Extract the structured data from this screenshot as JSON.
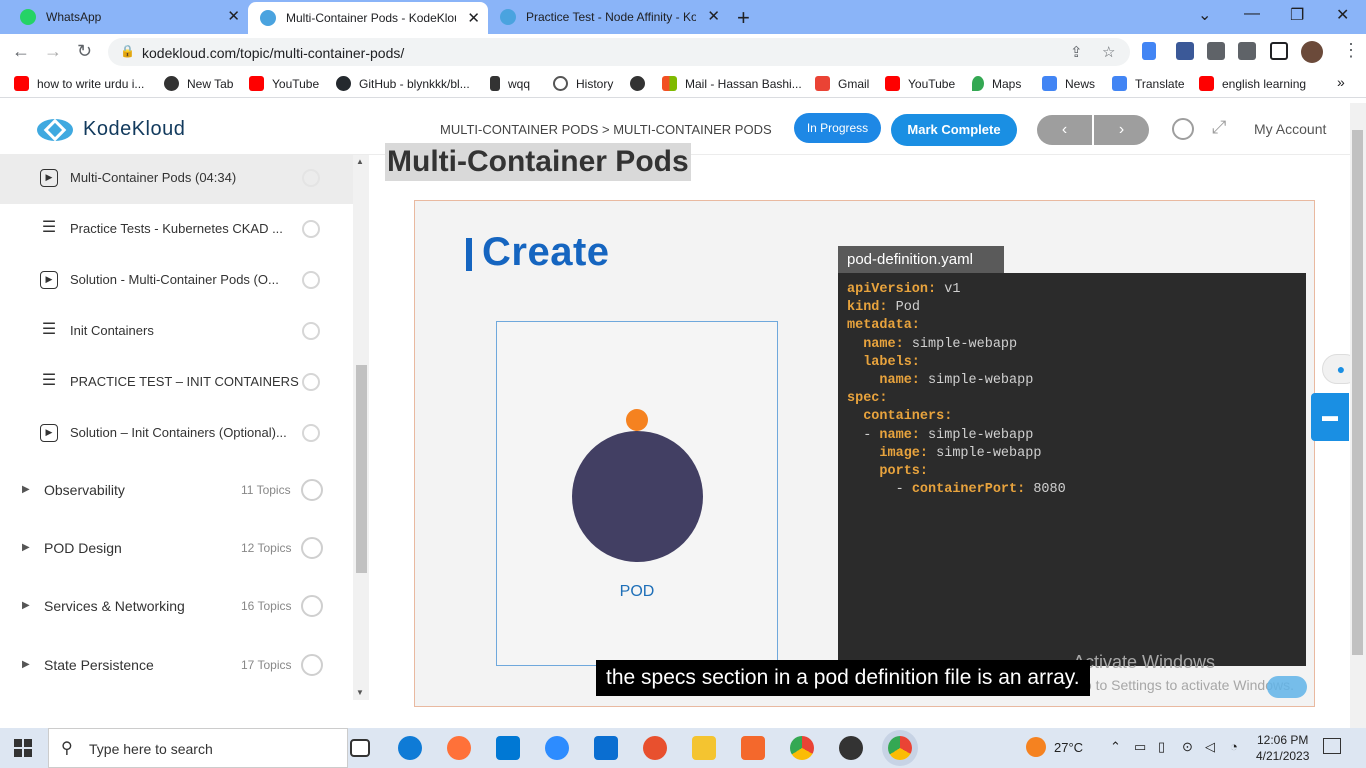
{
  "browser": {
    "tabs": [
      {
        "title": "WhatsApp",
        "color": "#25d366"
      },
      {
        "title": "Multi-Container Pods - KodeKloud",
        "color": "#4aa3df"
      },
      {
        "title": "Practice Test - Node Affinity - KodeKloud",
        "color": "#4aa3df"
      }
    ],
    "url": "kodekloud.com/topic/multi-container-pods/",
    "bookmarks": [
      {
        "label": "how to write urdu i...",
        "color": "#ff0000"
      },
      {
        "label": "New Tab",
        "color": "#333333"
      },
      {
        "label": "YouTube",
        "color": "#ff0000"
      },
      {
        "label": "GitHub - blynkkk/bl...",
        "color": "#24292e"
      },
      {
        "label": "wqq",
        "color": "#333333"
      },
      {
        "label": "History",
        "color": "#555555"
      },
      {
        "label": "",
        "color": "#333333"
      },
      {
        "label": "Mail - Hassan Bashi...",
        "color": "#f25022"
      },
      {
        "label": "Gmail",
        "color": "#ea4335"
      },
      {
        "label": "YouTube",
        "color": "#ff0000"
      },
      {
        "label": "Maps",
        "color": "#34a853"
      },
      {
        "label": "News",
        "color": "#4285f4"
      },
      {
        "label": "Translate",
        "color": "#4285f4"
      },
      {
        "label": "english learning",
        "color": "#ff0000"
      }
    ]
  },
  "header": {
    "logo": "KodeKloud",
    "breadcrumb": "MULTI-CONTAINER PODS > MULTI-CONTAINER PODS",
    "status_button": "In Progress",
    "complete_button": "Mark Complete",
    "prev_label": "‹",
    "next_label": "›",
    "account": "My Account"
  },
  "sidebar": {
    "lessons": [
      {
        "label": "Multi-Container Pods (04:34)",
        "icon": "play-icon",
        "active": true
      },
      {
        "label": "Practice Tests - Kubernetes CKAD ...",
        "icon": "doc-icon",
        "active": false
      },
      {
        "label": "Solution - Multi-Container Pods (O...",
        "icon": "play-icon",
        "active": false
      },
      {
        "label": "Init Containers",
        "icon": "doc-icon",
        "active": false
      },
      {
        "label": "PRACTICE TEST – INIT CONTAINERS",
        "icon": "doc-icon",
        "active": false
      },
      {
        "label": "Solution – Init Containers (Optional)...",
        "icon": "play-icon",
        "active": false
      }
    ],
    "sections": [
      {
        "label": "Observability",
        "count": "11 Topics"
      },
      {
        "label": "POD Design",
        "count": "12 Topics"
      },
      {
        "label": "Services & Networking",
        "count": "16 Topics"
      },
      {
        "label": "State Persistence",
        "count": "17 Topics"
      }
    ]
  },
  "main": {
    "title": "Multi-Container Pods",
    "slide": {
      "heading": "Create",
      "pod_label": "POD",
      "yaml_filename": "pod-definition.yaml",
      "yaml_lines": [
        {
          "indent": "",
          "key": "apiVersion:",
          "value": " v1"
        },
        {
          "indent": "",
          "key": "kind:",
          "value": " Pod"
        },
        {
          "indent": "",
          "key": "metadata:",
          "value": ""
        },
        {
          "indent": "  ",
          "key": "name:",
          "value": " simple-webapp"
        },
        {
          "indent": "  ",
          "key": "labels:",
          "value": ""
        },
        {
          "indent": "    ",
          "key": "name:",
          "value": " simple-webapp"
        },
        {
          "indent": "",
          "key": "spec:",
          "value": ""
        },
        {
          "indent": "  ",
          "key": "containers:",
          "value": ""
        },
        {
          "indent": "  - ",
          "key": "name:",
          "value": " simple-webapp"
        },
        {
          "indent": "    ",
          "key": "image:",
          "value": " simple-webapp"
        },
        {
          "indent": "    ",
          "key": "ports:",
          "value": ""
        },
        {
          "indent": "      - ",
          "key": "containerPort:",
          "value": " 8080"
        }
      ]
    },
    "caption": "the specs section in a pod definition file is an array.",
    "activate_title": "Activate Windows",
    "activate_sub": "Go to Settings to activate Windows."
  },
  "taskbar": {
    "search_placeholder": "Type here to search",
    "weather": "27°C",
    "time": "12:06 PM",
    "date": "4/21/2023"
  }
}
